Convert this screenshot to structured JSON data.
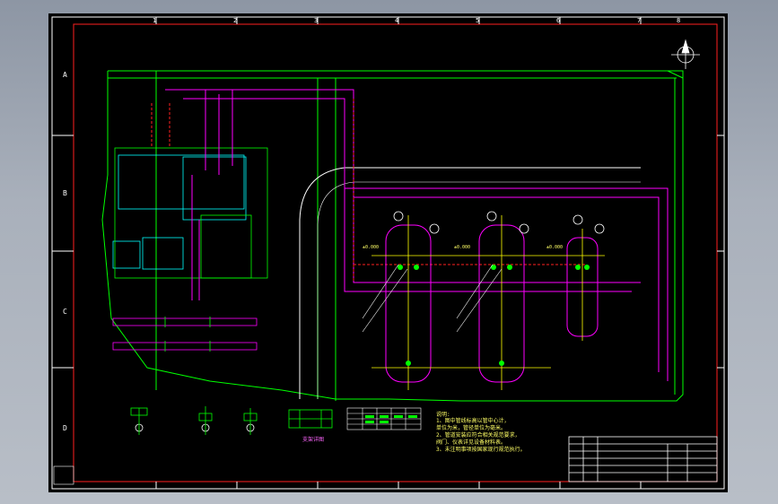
{
  "sheet": {
    "row_labels": [
      "A",
      "B",
      "C",
      "D"
    ],
    "column_markers": [
      "1",
      "2",
      "3",
      "4",
      "5",
      "6",
      "7",
      "8"
    ],
    "colors": {
      "background": "#000000",
      "border": "#ffffff",
      "frame": "#ff2020",
      "site": "#00ff00",
      "piping": "#ff00ff",
      "text": "#ffff00",
      "cyan": "#00ffff"
    }
  },
  "notes": {
    "title": "说明:",
    "lines": [
      "1、图中管线标高以管中心计，",
      "   单位为米，管径单位为毫米。",
      "2、管道安装应符合相关规范要求，",
      "   阀门、仪表详见设备材料表。",
      "3、未注明事项按国家现行规范执行。"
    ]
  },
  "labels": {
    "elevation_marks": [
      "±0.000",
      "±0.000",
      "±0.000"
    ],
    "detail_caption": "支架详图",
    "north_icon": "north-arrow-icon"
  },
  "title_block": {
    "rows": 6
  }
}
